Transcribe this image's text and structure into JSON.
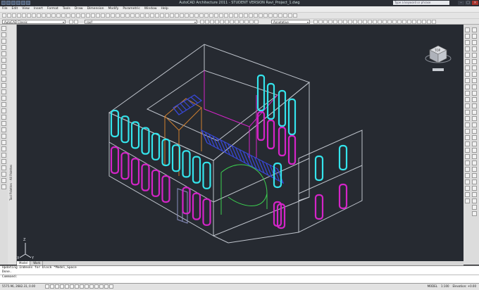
{
  "window": {
    "title": "AutoCAD Architecture 2011 - STUDENT VERSION    Ravi_Project_1.dwg",
    "search_placeholder": "Type a keyword or phrase"
  },
  "menubar": {
    "items": [
      "File",
      "Edit",
      "View",
      "Insert",
      "Format",
      "Tools",
      "Draw",
      "Dimension",
      "Modify",
      "Parametric",
      "Window",
      "Help"
    ]
  },
  "toolbar": {
    "workspace": "AutoCAD Classic",
    "layer": "roof",
    "annotation_scale": "Annotative"
  },
  "palette": {
    "label": "Tool Palettes - All Palettes"
  },
  "layout_tabs": [
    "Model",
    "Work"
  ],
  "command": {
    "history": [
      "Updating Indexes for block *Model_Space",
      "Done."
    ],
    "prompt": "Command:"
  },
  "status": {
    "coordinates": "5575.96, 2682.31, 0.00",
    "mode": "MODEL",
    "scale": "1:100",
    "elevation": "Elevation: +0.00"
  },
  "viewcube": {
    "face": "TOP"
  },
  "colors": {
    "background": "#262a31",
    "white_lines": "#bfc4cc",
    "cyan_windows": "#34e4ec",
    "magenta_windows": "#d424c8",
    "blue_stairs": "#3848d8",
    "orange_stair": "#d08030",
    "green_curve": "#3cd050"
  }
}
